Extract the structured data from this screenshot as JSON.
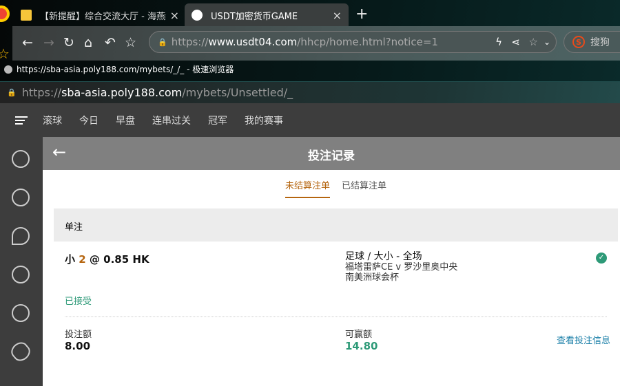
{
  "browser": {
    "tabs": [
      {
        "label": "【新提醒】综合交流大厅 - 海燕绿",
        "close": "×"
      },
      {
        "label": "USDT加密货币GAME",
        "close": "×"
      }
    ],
    "new_tab": "+",
    "address": {
      "prefix": "https://",
      "host": "www.usdt04.com",
      "path": "/hhcp/home.html?notice=1"
    },
    "search_engine": "搜狗",
    "status": "https://sba-asia.poly188.com/mybets/_/_ - 极速浏览器",
    "address2": {
      "prefix": "https://",
      "host": "sba-asia.poly188.com",
      "path": "/mybets/Unsettled/_"
    }
  },
  "nav": {
    "items": [
      "滚球",
      "今日",
      "早盘",
      "连串过关",
      "冠军",
      "我的赛事"
    ]
  },
  "sidebar": {
    "icons": [
      "soccer-icon",
      "basketball-icon",
      "tennis-icon",
      "volleyball-icon",
      "baseball-icon",
      "football-icon"
    ]
  },
  "header": {
    "title": "投注记录",
    "back": "←"
  },
  "tabs": [
    {
      "label": "未结算注单",
      "active": true
    },
    {
      "label": "已结算注单",
      "active": false
    }
  ],
  "section": {
    "title": "单注"
  },
  "bet": {
    "selection": "小",
    "line": "2",
    "at": "@",
    "odds": "0.85 HK",
    "market": "足球 / 大小 - 全场",
    "match": "福塔雷萨CE v 罗沙里奥中央",
    "league": "南美洲球会杯",
    "status": "已接受",
    "stake_label": "投注额",
    "stake": "8.00",
    "win_label": "可赢额",
    "win": "14.80",
    "details_link": "查看投注信息"
  },
  "colors": {
    "accent": "#b5650f",
    "success": "#2e9a78",
    "link": "#1a7fa8"
  }
}
